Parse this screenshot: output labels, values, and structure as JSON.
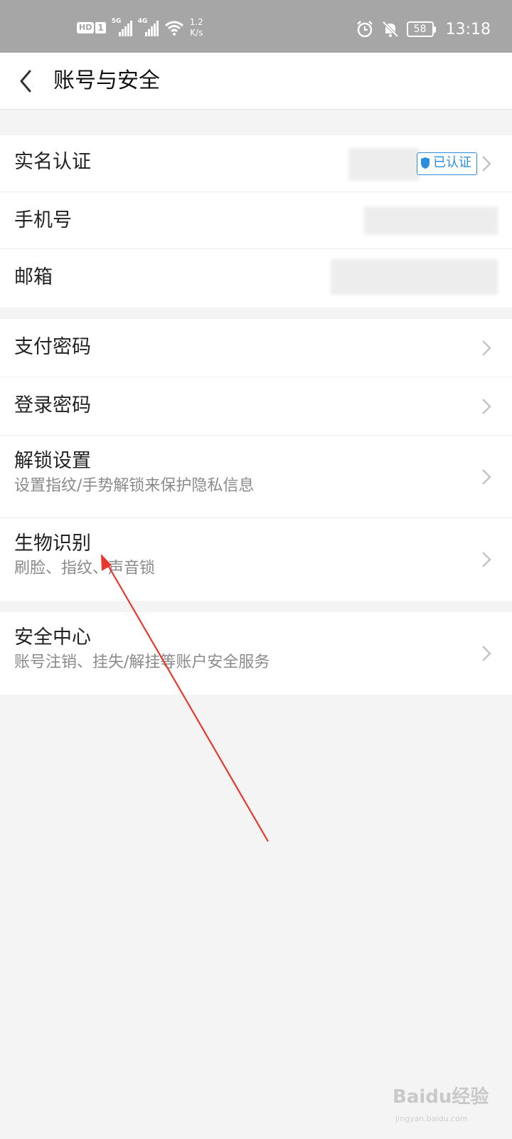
{
  "status_bar": {
    "hd": "HD",
    "sim": "1",
    "net1": "5G",
    "net2": "4G",
    "speed_value": "1.2",
    "speed_unit": "K/s",
    "battery": "58",
    "time": "13:18"
  },
  "header": {
    "title": "账号与安全"
  },
  "section1": {
    "real_name": {
      "label": "实名认证",
      "badge": "已认证"
    },
    "phone": {
      "label": "手机号"
    },
    "email": {
      "label": "邮箱"
    }
  },
  "section2": {
    "pay_password": {
      "label": "支付密码"
    },
    "login_password": {
      "label": "登录密码"
    },
    "unlock": {
      "label": "解锁设置",
      "sub": "设置指纹/手势解锁来保护隐私信息"
    },
    "biometric": {
      "label": "生物识别",
      "sub": "刷脸、指纹、声音锁"
    }
  },
  "section3": {
    "security_center": {
      "label": "安全中心",
      "sub": "账号注销、挂失/解挂等账户安全服务"
    }
  },
  "watermark": {
    "brand": "Baidu经验",
    "url": "jingyan.baidu.com"
  },
  "colors": {
    "accent": "#2b8de0",
    "annotation_arrow": "#e8372c",
    "status_bar_bg": "#a6a6a6"
  }
}
